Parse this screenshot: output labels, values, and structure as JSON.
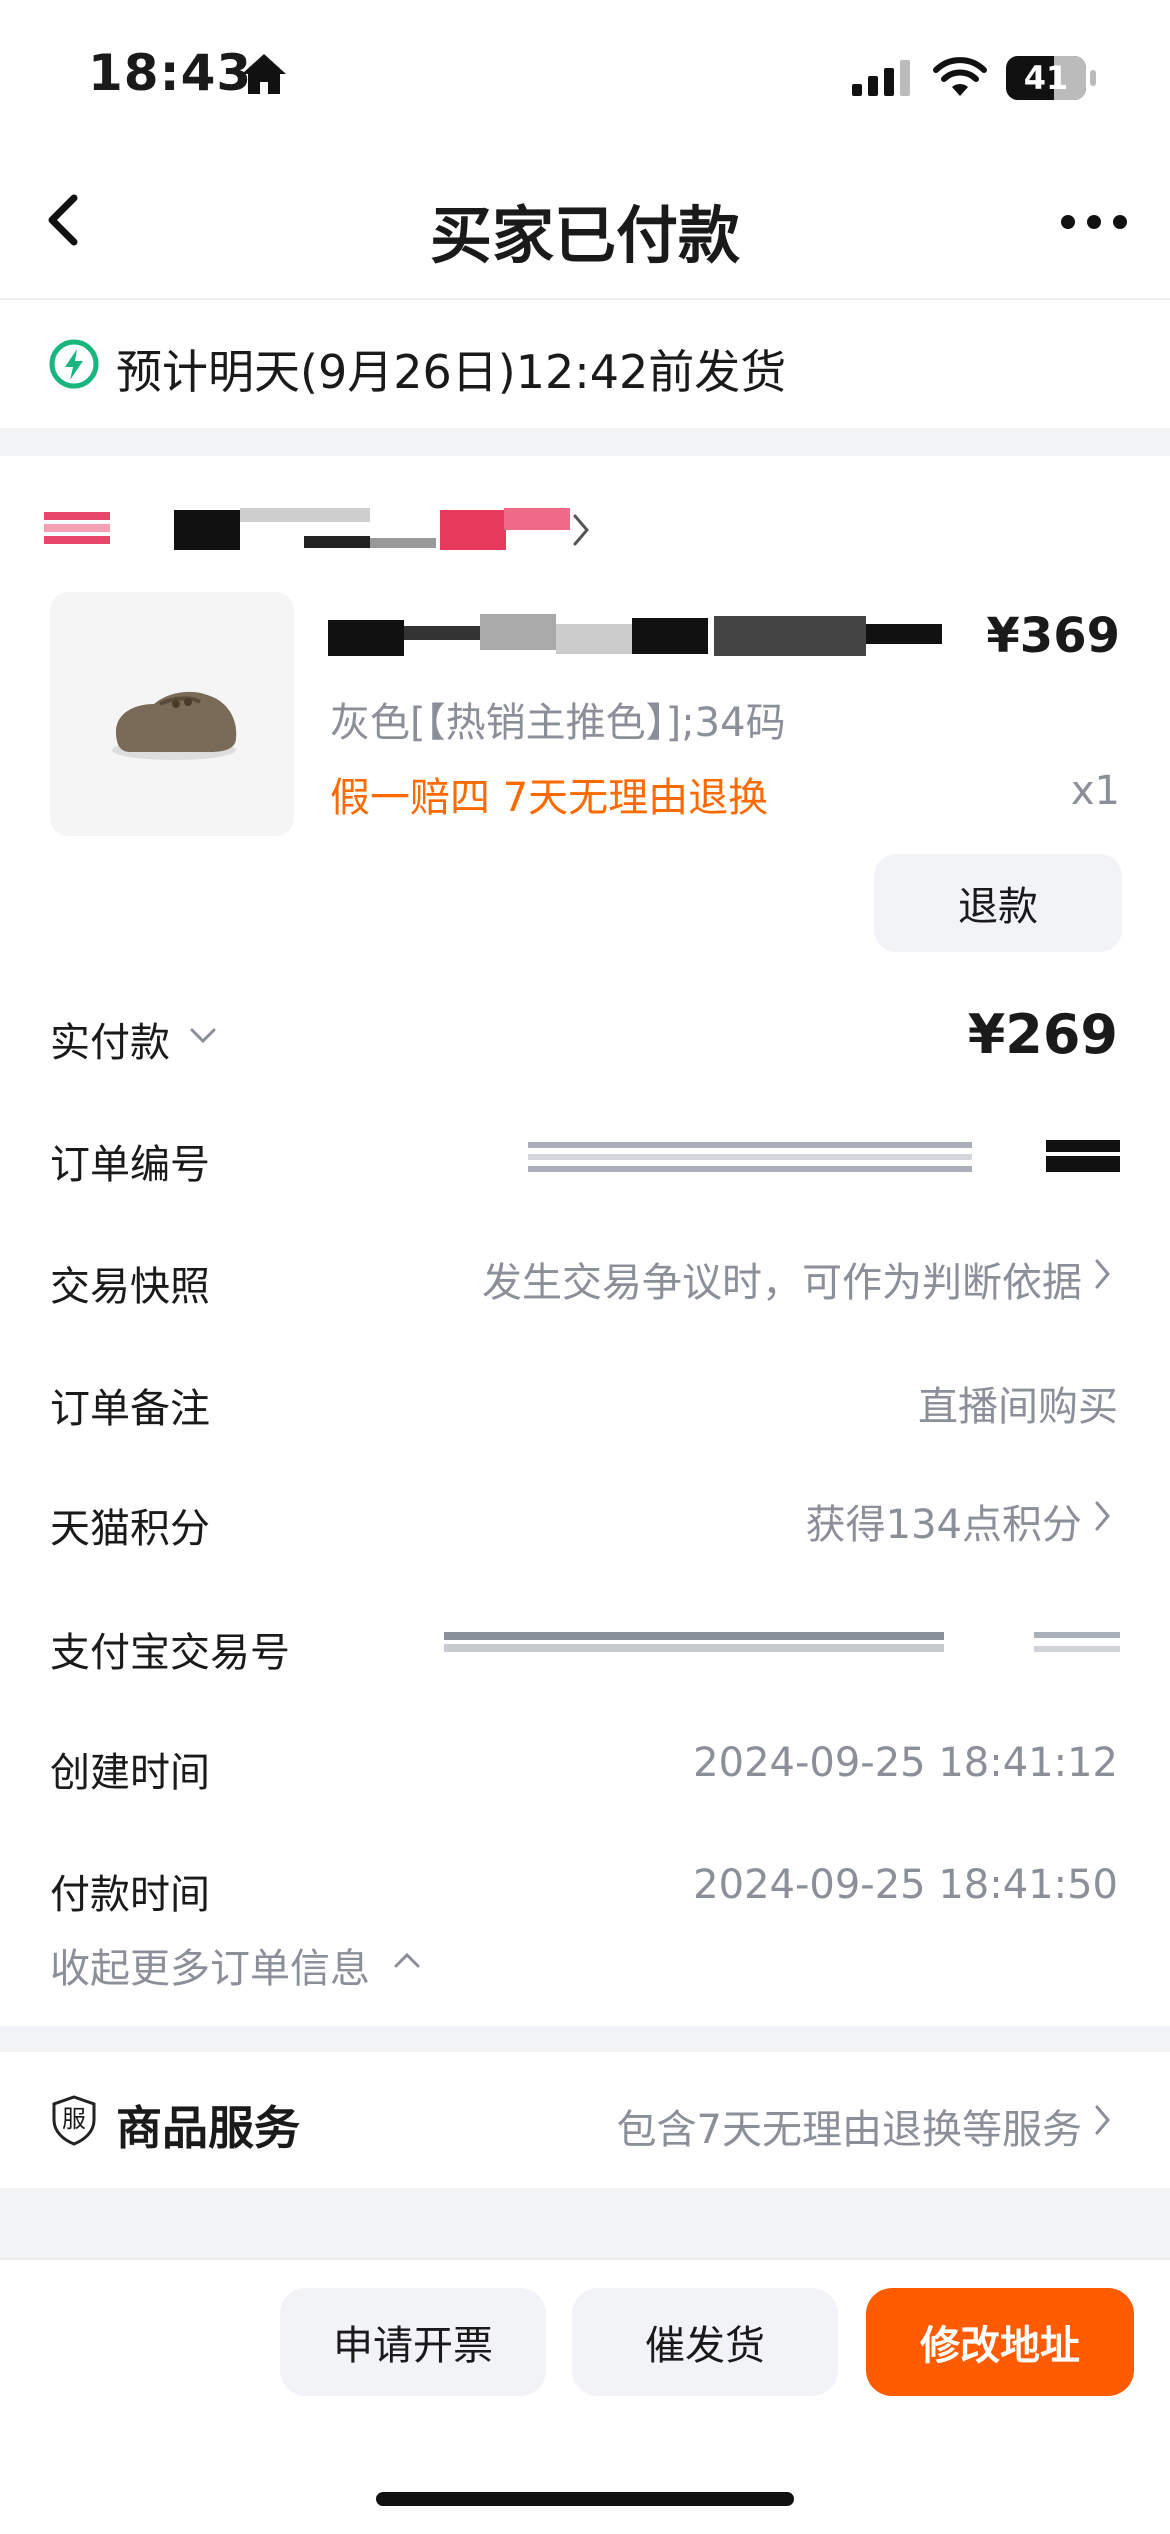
{
  "status_bar": {
    "time": "18:43",
    "battery": "41"
  },
  "nav": {
    "title": "买家已付款"
  },
  "shipping": {
    "text": "预计明天(9月26日)12:42前发货"
  },
  "item": {
    "price": "¥369",
    "sku": "灰色[【热销主推色】];34码",
    "tags": "假一赔四  7天无理由退换",
    "qty": "x1",
    "refund_label": "退款"
  },
  "order": {
    "paid_label": "实付款",
    "paid_value": "¥269",
    "number_label": "订单编号",
    "snapshot_label": "交易快照",
    "snapshot_value": "发生交易争议时，可作为判断依据",
    "note_label": "订单备注",
    "note_value": "直播间购买",
    "points_label": "天猫积分",
    "points_value": "获得134点积分",
    "alipay_label": "支付宝交易号",
    "created_label": "创建时间",
    "created_value": "2024-09-25 18:41:12",
    "paytime_label": "付款时间",
    "paytime_value": "2024-09-25 18:41:50",
    "collapse_label": "收起更多订单信息"
  },
  "service": {
    "icon_text": "服",
    "title": "商品服务",
    "value": "包含7天无理由退换等服务"
  },
  "actions": {
    "invoice": "申请开票",
    "urge": "催发货",
    "change_address": "修改地址"
  },
  "colors": {
    "accent": "#ff5b00",
    "tag_orange": "#ff6a00",
    "ship_green": "#19b67e"
  }
}
